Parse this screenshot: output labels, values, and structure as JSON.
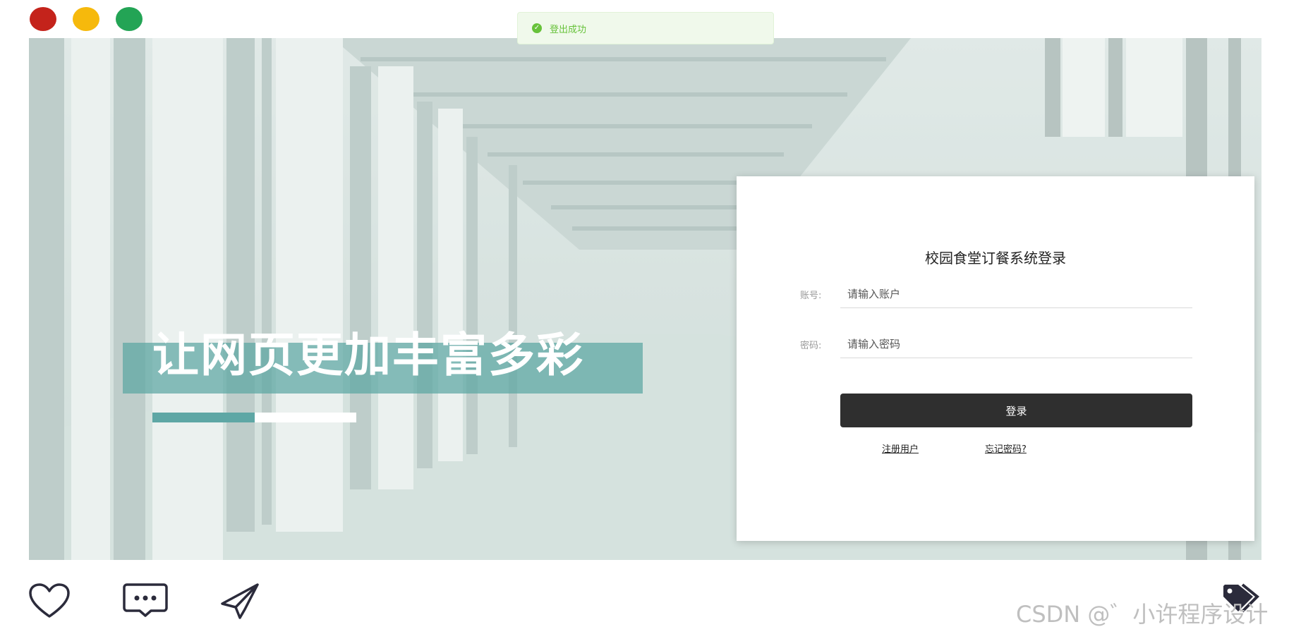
{
  "toast": {
    "message": "登出成功",
    "icon": "check-circle-icon",
    "color": "#67c23a"
  },
  "hero": {
    "slogan": "让网页更加丰富多彩",
    "progress": 0.5
  },
  "login": {
    "title": "校园食堂订餐系统登录",
    "account_label": "账号:",
    "account_placeholder": "请输入账户",
    "password_label": "密码:",
    "password_placeholder": "请输入密码",
    "login_button": "登录",
    "register_link": "注册用户",
    "forgot_link": "忘记密码?"
  },
  "bottom_bar": {
    "icons": [
      "heart-icon",
      "comment-icon",
      "send-icon",
      "tags-icon"
    ]
  },
  "watermark": "CSDN @゛小许程序设计",
  "colors": {
    "accent": "#5ea7a5",
    "button": "#2f2f2f",
    "success": "#67c23a"
  }
}
